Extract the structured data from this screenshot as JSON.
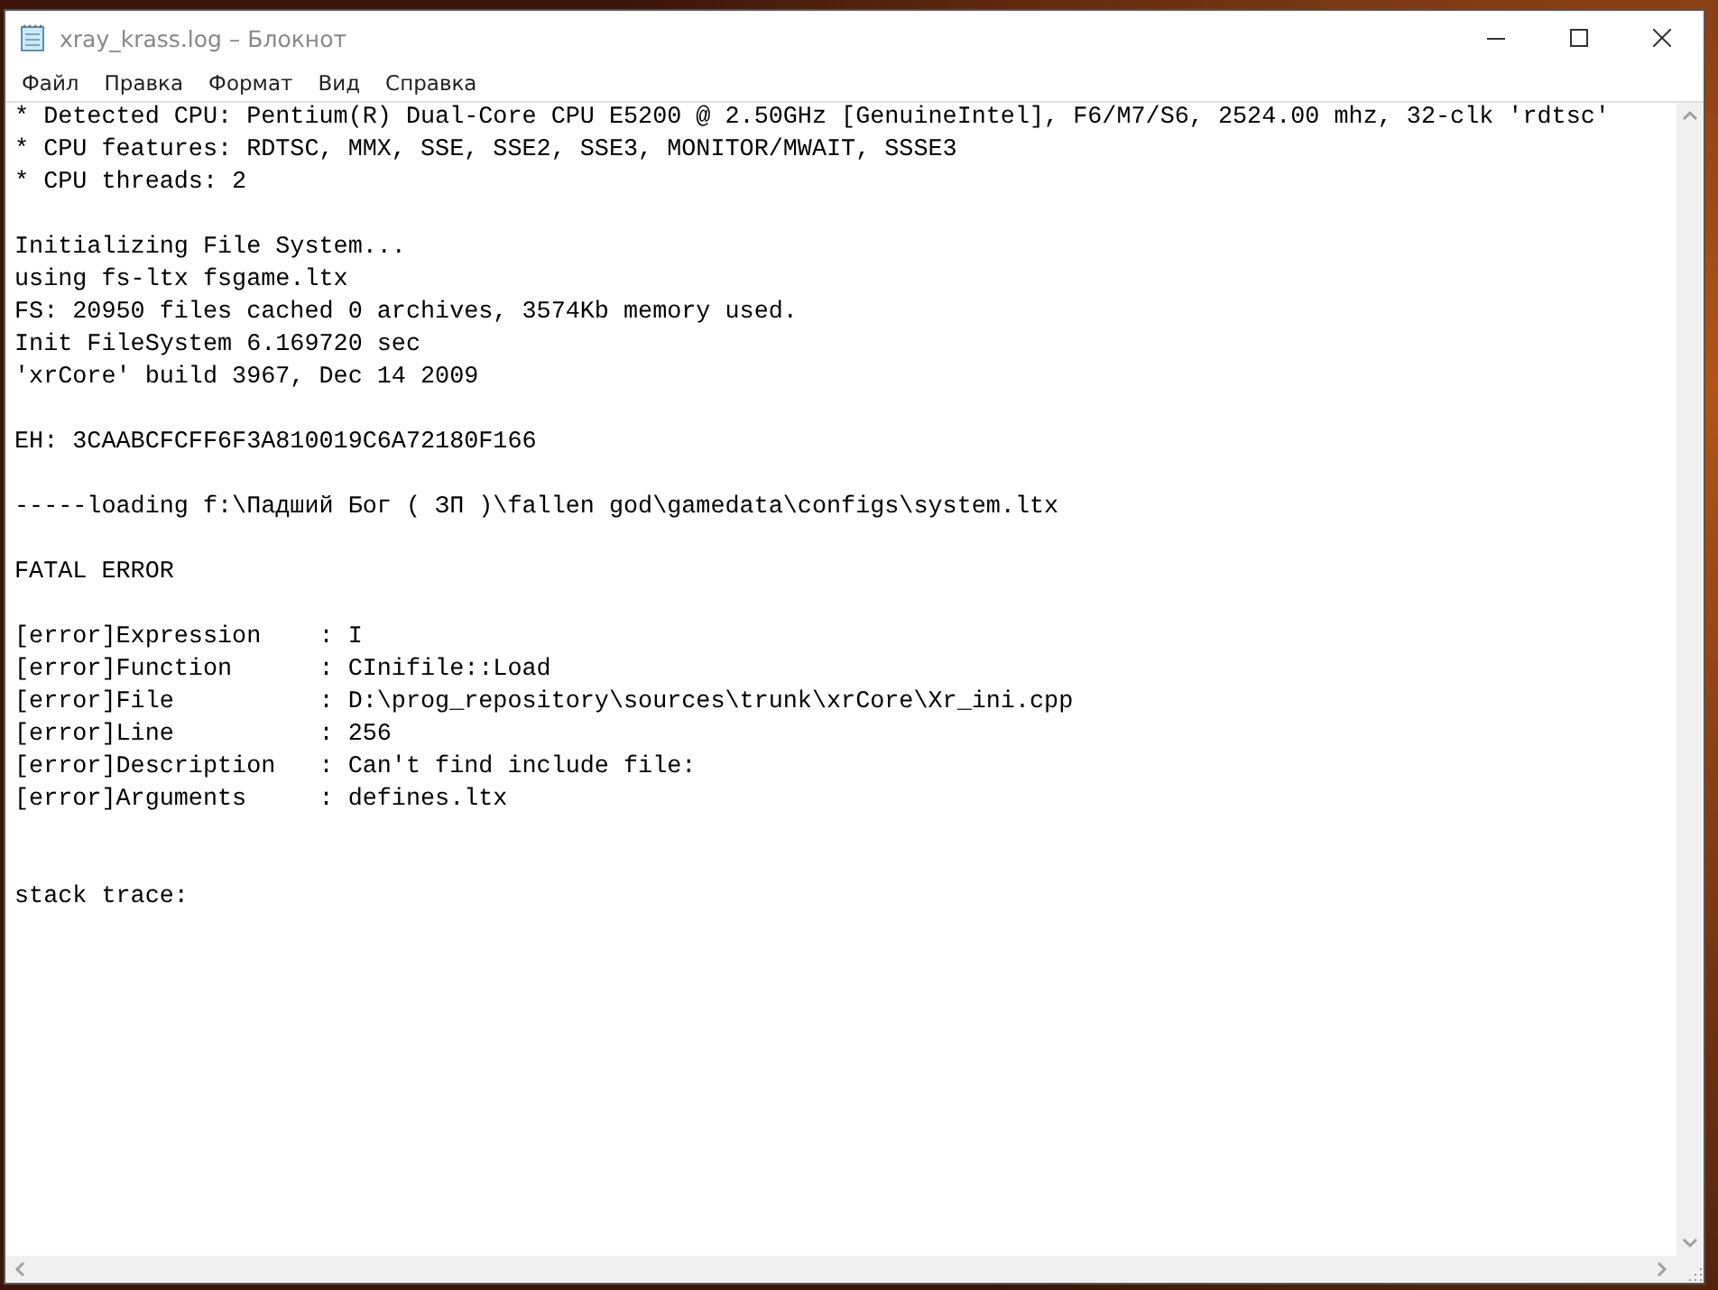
{
  "window": {
    "title": "xray_krass.log – Блокнот"
  },
  "menu": [
    "Файл",
    "Правка",
    "Формат",
    "Вид",
    "Справка"
  ],
  "lines": [
    {
      "kind": "text",
      "text": "* Detected CPU: Pentium(R) Dual-Core CPU E5200 @ 2.50GHz [GenuineIntel], F6/M7/S6, 2524.00 mhz, 32-clk 'rdtsc'"
    },
    {
      "kind": "text",
      "text": "* CPU features: RDTSC, MMX, SSE, SSE2, SSE3, MONITOR/MWAIT, SSSE3"
    },
    {
      "kind": "text",
      "text": "* CPU threads: 2"
    },
    {
      "kind": "blank"
    },
    {
      "kind": "text",
      "text": "Initializing File System..."
    },
    {
      "kind": "text",
      "text": "using fs-ltx fsgame.ltx"
    },
    {
      "kind": "text",
      "text": "FS: 20950 files cached 0 archives, 3574Kb memory used."
    },
    {
      "kind": "text",
      "text": "Init FileSystem 6.169720 sec"
    },
    {
      "kind": "text",
      "text": "'xrCore' build 3967, Dec 14 2009"
    },
    {
      "kind": "blank"
    },
    {
      "kind": "text",
      "text": "EH: 3CAABCFCFF6F3A810019C6A72180F166"
    },
    {
      "kind": "blank"
    },
    {
      "kind": "text",
      "text": "-----loading f:\\Падший Бог ( ЗП )\\fallen god\\gamedata\\configs\\system.ltx"
    },
    {
      "kind": "blank"
    },
    {
      "kind": "text",
      "text": "FATAL ERROR"
    },
    {
      "kind": "blank"
    },
    {
      "kind": "text",
      "text": "[error]Expression    : I"
    },
    {
      "kind": "text",
      "text": "[error]Function      : CInifile::Load"
    },
    {
      "kind": "text",
      "text": "[error]File          : D:\\prog_repository\\sources\\trunk\\xrCore\\Xr_ini.cpp"
    },
    {
      "kind": "text",
      "text": "[error]Line          : 256"
    },
    {
      "kind": "text",
      "text": "[error]Description   : Can't find include file:"
    },
    {
      "kind": "text",
      "text": "[error]Arguments     : defines.ltx"
    },
    {
      "kind": "blank"
    },
    {
      "kind": "blank"
    },
    {
      "kind": "text",
      "text": "stack trace:"
    }
  ]
}
